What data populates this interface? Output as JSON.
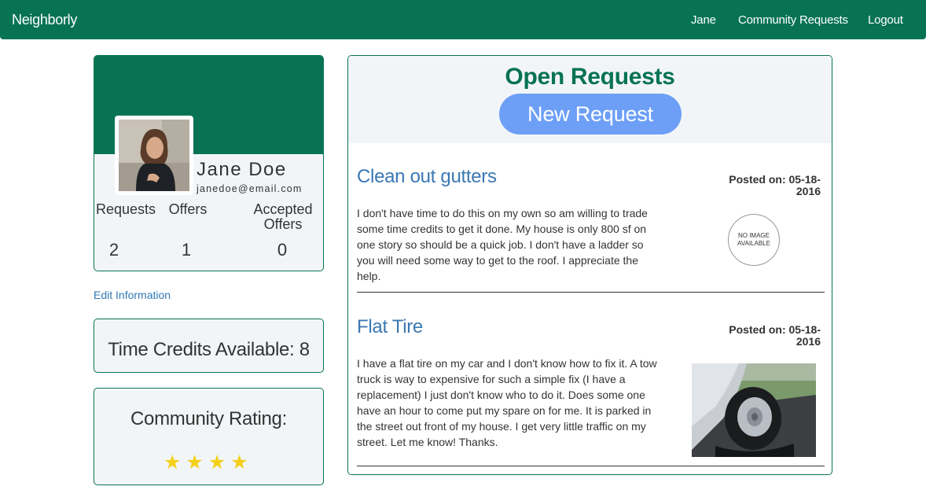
{
  "nav": {
    "brand": "Neighborly",
    "links": [
      "Jane",
      "Community Requests",
      "Logout"
    ]
  },
  "profile": {
    "name": "Jane Doe",
    "email": "janedoe@email.com",
    "stats": [
      {
        "label": "Requests",
        "value": "2"
      },
      {
        "label": "Offers",
        "value": "1"
      },
      {
        "label": "Accepted Offers",
        "value": "0"
      }
    ],
    "edit_link": "Edit Information"
  },
  "credits": {
    "text": "Time Credits Available: 8"
  },
  "rating": {
    "title": "Community Rating:",
    "stars": 4,
    "stars_text": "★★★★",
    "star_color": "#f4d01a"
  },
  "requests": {
    "title": "Open Requests",
    "new_button": "New Request",
    "items": [
      {
        "title": "Clean out gutters",
        "posted": "Posted on: 05-18-2016",
        "description": "I don't have time to do this on my own so am willing to trade some time credits to get it done. My house is only 800 sf on one story so should be a quick job. I don't have a ladder so you will need some way to get to the roof. I appreciate the help.",
        "image_placeholder": "NO IMAGE AVAILABLE"
      },
      {
        "title": "Flat Tire",
        "posted": "Posted on: 05-18-2016",
        "description": "I have a flat tire on my car and I don't know how to fix it. A tow truck is way to expensive for such a simple fix (I have a replacement) I just don't know who to do it. Does some one have an hour to come put my spare on for me. It is parked in the street out front of my house. I get very little traffic on my street. Let me know! Thanks."
      }
    ]
  },
  "colors": {
    "brand_green": "#077352",
    "link_blue": "#3a78b3",
    "button_blue": "#6d9ff7",
    "card_bg": "#f2f5f8"
  }
}
